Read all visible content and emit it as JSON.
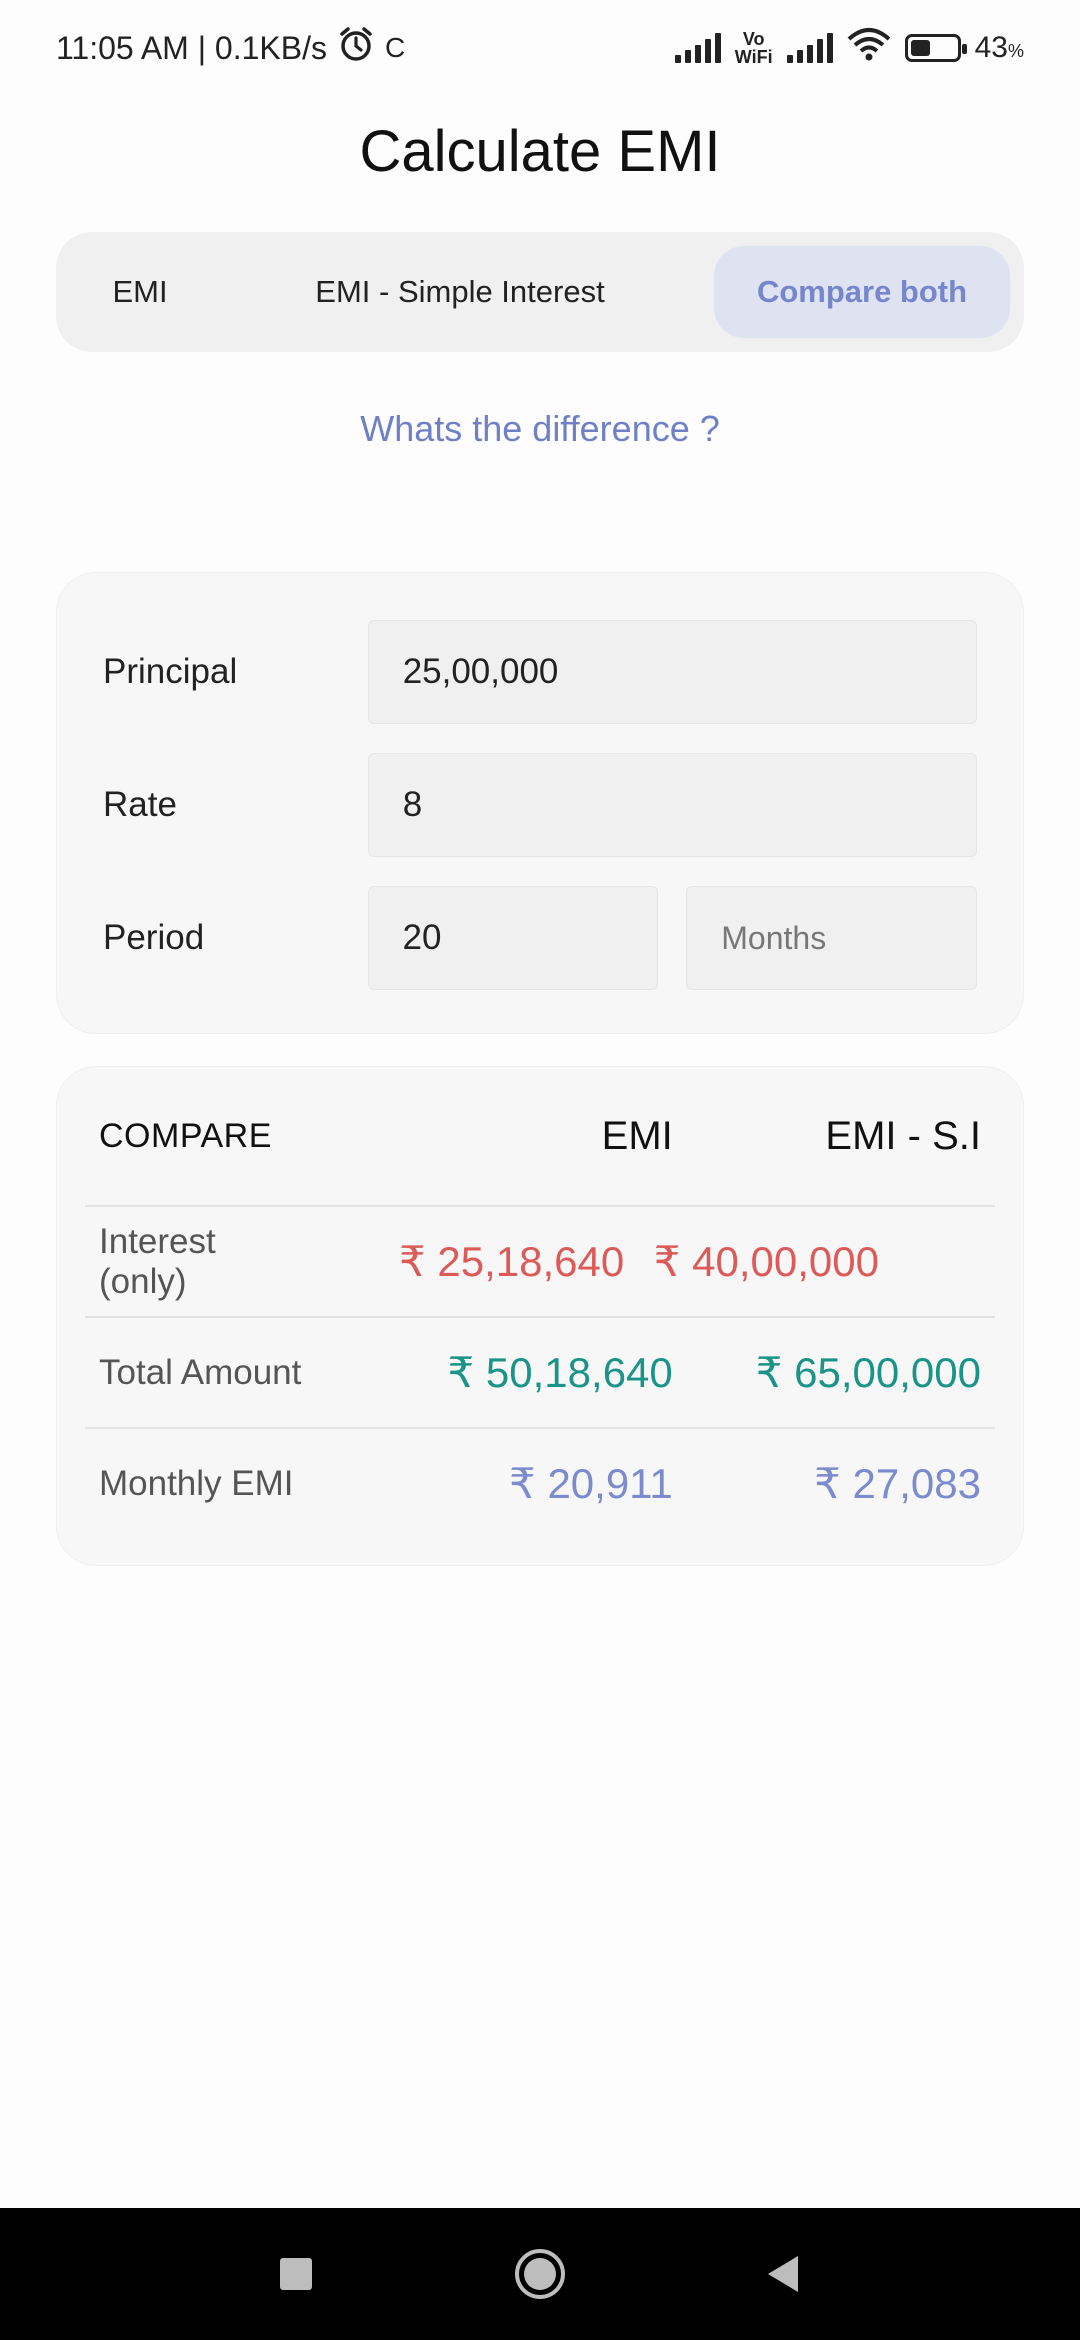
{
  "status_bar": {
    "time": "11:05 AM | 0.1KB/s",
    "extra": "C",
    "vowifi_top": "Vo",
    "vowifi_bottom": "WiFi",
    "battery_percent": "43",
    "battery_unit": "%",
    "battery_level": 0.43
  },
  "title": "Calculate EMI",
  "tabs": [
    {
      "label": "EMI",
      "selected": false
    },
    {
      "label": "EMI - Simple Interest",
      "selected": false
    },
    {
      "label": "Compare both",
      "selected": true
    }
  ],
  "difference_link": "Whats the difference ?",
  "inputs": {
    "principal": {
      "label": "Principal",
      "value": "25,00,000"
    },
    "rate": {
      "label": "Rate",
      "value": "8"
    },
    "period": {
      "label": "Period",
      "value": "20",
      "unit_placeholder": "Months"
    }
  },
  "compare": {
    "header": {
      "label": "COMPARE",
      "col1": "EMI",
      "col2": "EMI - S.I"
    },
    "rows": [
      {
        "label": "Interest (only)",
        "emi": "₹ 25,18,640",
        "emi_si": "₹ 40,00,000"
      },
      {
        "label": "Total Amount",
        "emi": "₹ 50,18,640",
        "emi_si": "₹ 65,00,000"
      },
      {
        "label": "Monthly EMI",
        "emi": "₹ 20,911",
        "emi_si": "₹ 27,083"
      }
    ]
  },
  "colors": {
    "accent": "#7686cc",
    "interest": "#dc5a58",
    "total": "#1a9488",
    "monthly": "#7b8bce"
  },
  "nav": {
    "icons": [
      "recents-square-icon",
      "home-circle-icon",
      "back-triangle-icon"
    ]
  }
}
